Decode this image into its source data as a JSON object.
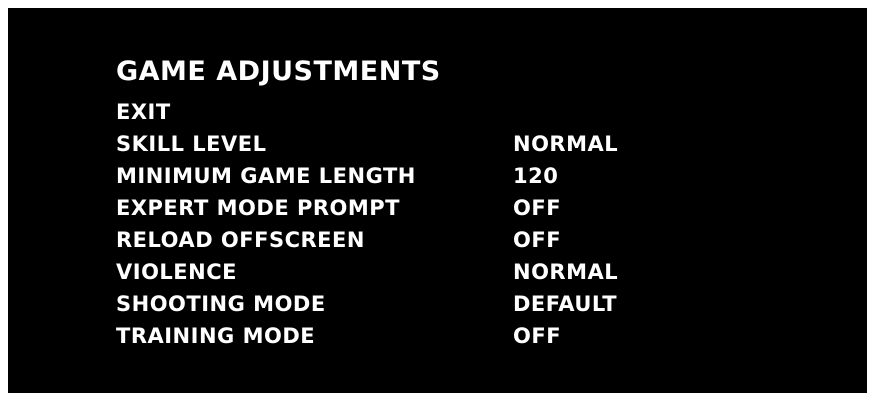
{
  "menu": {
    "title": "GAME ADJUSTMENTS",
    "items": [
      {
        "label": "EXIT",
        "value": ""
      },
      {
        "label": "SKILL LEVEL",
        "value": "NORMAL"
      },
      {
        "label": "MINIMUM GAME LENGTH",
        "value": "120"
      },
      {
        "label": "EXPERT MODE PROMPT",
        "value": "OFF"
      },
      {
        "label": "RELOAD OFFSCREEN",
        "value": "OFF"
      },
      {
        "label": "VIOLENCE",
        "value": "NORMAL"
      },
      {
        "label": "SHOOTING MODE",
        "value": "DEFAULT"
      },
      {
        "label": "TRAINING MODE",
        "value": "OFF"
      }
    ]
  },
  "colors": {
    "background": "#000000",
    "text": "#ffffff",
    "frame": "#ffffff"
  }
}
